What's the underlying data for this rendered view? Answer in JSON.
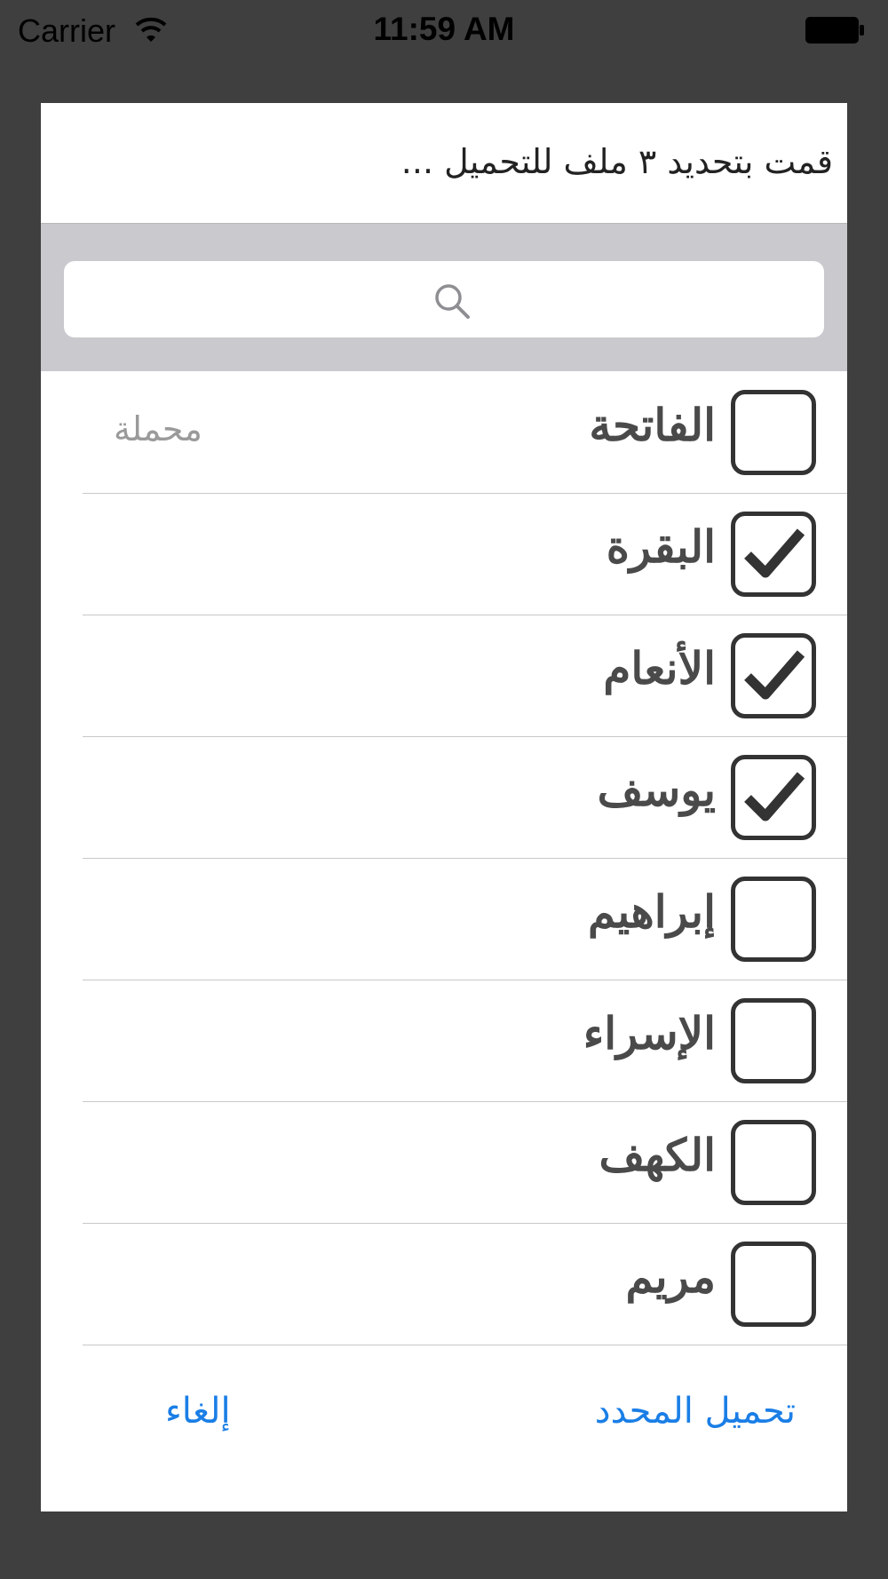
{
  "status_bar": {
    "carrier": "Carrier",
    "time": "11:59 AM",
    "wifi_icon": "wifi-icon",
    "battery_icon": "battery-full-icon"
  },
  "dialog": {
    "title": "قمت بتحديد ٣ ملف للتحميل ...",
    "search": {
      "placeholder": "",
      "value": "",
      "icon": "search-icon"
    },
    "items": [
      {
        "label": "الفاتحة",
        "checked": false,
        "status": "محملة"
      },
      {
        "label": "البقرة",
        "checked": true,
        "status": ""
      },
      {
        "label": "الأنعام",
        "checked": true,
        "status": ""
      },
      {
        "label": "يوسف",
        "checked": true,
        "status": ""
      },
      {
        "label": "إبراهيم",
        "checked": false,
        "status": ""
      },
      {
        "label": "الإسراء",
        "checked": false,
        "status": ""
      },
      {
        "label": "الكهف",
        "checked": false,
        "status": ""
      },
      {
        "label": "مريم",
        "checked": false,
        "status": ""
      }
    ],
    "buttons": {
      "cancel": "إلغاء",
      "download_selected": "تحميل المحدد"
    }
  },
  "colors": {
    "backdrop": "#3f3f3f",
    "search_bar_bg": "#c9c9ce",
    "accent": "#1a7ee6",
    "checkbox_border": "#333333",
    "status_text": "#9a9a9a"
  }
}
